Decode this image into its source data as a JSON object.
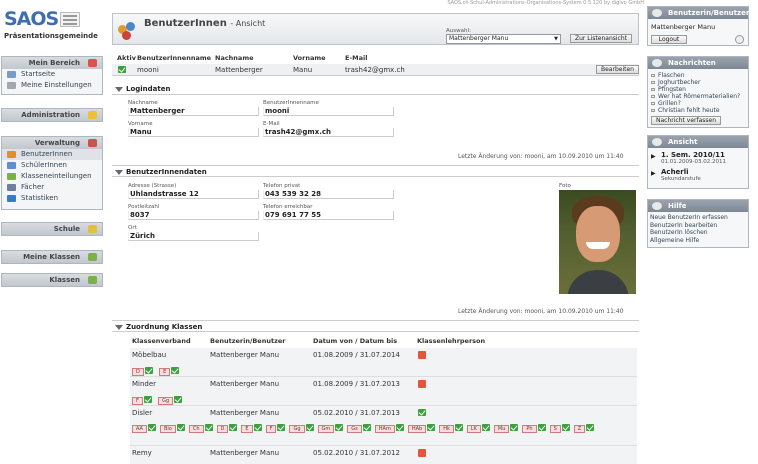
{
  "topbar": "SAOS.ch Schul-Administrations-Organisations-System 0.5.120 by digivo GmbH",
  "app": {
    "logo": "SAOS",
    "org": "Präsentationsgemeinde"
  },
  "left": {
    "mein_bereich": {
      "title": "Mein Bereich",
      "items": [
        "Startseite",
        "Meine Einstellungen"
      ]
    },
    "administration": {
      "title": "Administration"
    },
    "verwaltung": {
      "title": "Verwaltung",
      "items": [
        "BenutzerInnen",
        "SchülerInnen",
        "Klasseneinteilungen",
        "Fächer",
        "Statistiken"
      ]
    },
    "schule": {
      "title": "Schule"
    },
    "meine_klassen": {
      "title": "Meine Klassen"
    },
    "klassen": {
      "title": "Klassen"
    }
  },
  "main": {
    "title": "BenutzerInnen",
    "subtitle": "- Ansicht",
    "auswahl_label": "Auswahl:",
    "auswahl_value": "Mattenberger Manu",
    "back_button": "Zur Listenansicht",
    "user_table": {
      "headers": [
        "Aktiv",
        "BenutzerInnenname",
        "Nachname",
        "Vorname",
        "E-Mail"
      ],
      "row": {
        "username": "mooni",
        "nachname": "Mattenberger",
        "vorname": "Manu",
        "email": "trash42@gmx.ch"
      },
      "edit_button": "Bearbeiten"
    },
    "logindaten": {
      "title": "Logindaten",
      "nachname_label": "Nachname",
      "nachname": "Mattenberger",
      "username_label": "BenutzerInnenname",
      "username": "mooni",
      "vorname_label": "Vorname",
      "vorname": "Manu",
      "email_label": "E-Mail",
      "email": "trash42@gmx.ch",
      "last_change": "Letzte Änderung von: mooni, am 10.09.2010 um 11:40"
    },
    "benutzerdaten": {
      "title": "BenutzerInnendaten",
      "adresse_label": "Adresse (Strasse)",
      "adresse": "Uhlandstrasse 12",
      "tel_privat_label": "Telefon privat",
      "tel_privat": "043 539 32 28",
      "plz_label": "Postleitzahl",
      "plz": "8037",
      "tel_erreichbar_label": "Telefon erreichbar",
      "tel_erreichbar": "079 691 77 55",
      "ort_label": "Ort",
      "ort": "Zürich",
      "foto_label": "Foto",
      "last_change": "Letzte Änderung von: mooni, am 10.09.2010 um 11:40"
    },
    "klassen": {
      "title": "Zuordnung Klassen",
      "headers": [
        "Klassenverband",
        "Benutzerin/Benutzer",
        "Datum von / Datum bis",
        "Klassenlehrperson"
      ],
      "rows": [
        {
          "klasse": "Möbelbau",
          "user": "Mattenberger Manu",
          "datum": "01.08.2009 / 31.07.2014",
          "tags": [
            "D",
            "E"
          ],
          "klp": "x"
        },
        {
          "klasse": "Minder",
          "user": "Mattenberger Manu",
          "datum": "01.08.2009 / 31.07.2013",
          "tags": [
            "F",
            "Gg"
          ],
          "klp": "x"
        },
        {
          "klasse": "Disler",
          "user": "Mattenberger Manu",
          "datum": "05.02.2010 / 31.07.2013",
          "tags": [
            "AA",
            "Bio",
            "Ch",
            "D",
            "E",
            "F",
            "Gg",
            "Gm",
            "Gs",
            "HAm",
            "HAb",
            "Hk",
            "LK",
            "Mu",
            "Ph",
            "S",
            "Z"
          ],
          "klp": "check"
        },
        {
          "klasse": "Remy",
          "user": "Mattenberger Manu",
          "datum": "05.02.2010 / 31.07.2012",
          "tags": [],
          "klp": "x"
        }
      ]
    }
  },
  "right": {
    "benutzer": {
      "title": "Benutzerin/Benutzer",
      "name": "Mattenberger Manu",
      "logout": "Logout"
    },
    "nachrichten": {
      "title": "Nachrichten",
      "items": [
        "Flaschen",
        "Joghurtbecher",
        "Pfingsten",
        "Wer hat Römermaterialien?",
        "Grillen?",
        "Christian fehlt heute"
      ],
      "button": "Nachricht verfassen"
    },
    "ansicht": {
      "title": "Ansicht",
      "semester": "1. Sem. 2010/11",
      "semester_dates": "01.01.2009-03.02.2011",
      "schule": "Acherli",
      "stufe": "Sekundarstufe"
    },
    "hilfe": {
      "title": "Hilfe",
      "items": [
        "Neue BenutzerIn erfassen",
        "BenutzerIn bearbeiten",
        "BenutzerIn löschen",
        "Allgemeine Hilfe"
      ]
    }
  }
}
